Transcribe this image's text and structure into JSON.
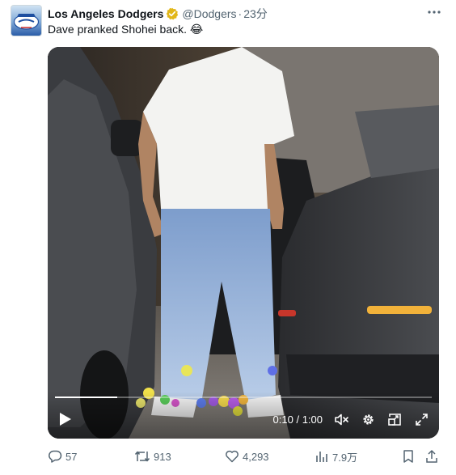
{
  "tweet": {
    "author_name": "Los Angeles Dodgers",
    "handle": "@Dodgers",
    "separator": "·",
    "time": "23分",
    "text": "Dave pranked Shohei back.",
    "emoji": "😂",
    "more_icon": "more-icon"
  },
  "video": {
    "current_time": "0:10",
    "duration": "1:00",
    "time_separator": " / ",
    "progress": 0.166,
    "icons": [
      "play-icon",
      "mute-icon",
      "settings-icon",
      "pip-icon",
      "fullscreen-icon"
    ]
  },
  "actions": {
    "replies": "57",
    "reposts": "913",
    "likes": "4,293",
    "views": "7.9万",
    "icons": [
      "reply-icon",
      "repost-icon",
      "like-icon",
      "views-icon",
      "bookmark-icon",
      "share-icon"
    ]
  },
  "colors": {
    "verified_badge": "#e2b719",
    "secondary_text": "#536471",
    "primary_text": "#0f1419"
  }
}
